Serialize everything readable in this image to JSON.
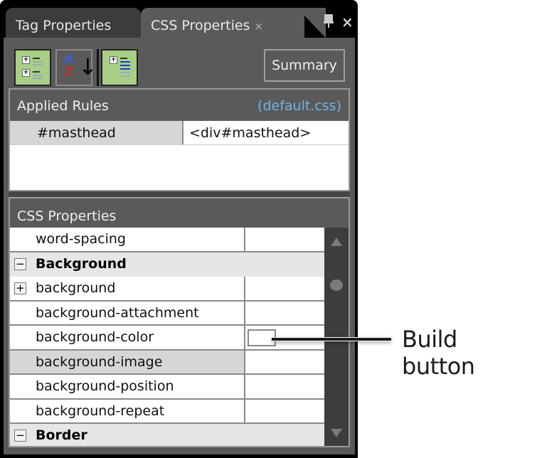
{
  "tabs": [
    {
      "label": "Tag Properties",
      "active": false
    },
    {
      "label": "CSS Properties",
      "active": true,
      "close_glyph": "×"
    }
  ],
  "window_controls": {
    "pin": "pin-icon",
    "close": "×"
  },
  "toolbar": {
    "buttons": [
      {
        "name": "show-categorized-list",
        "icon": "categorized-list-icon",
        "active": true
      },
      {
        "name": "show-alphabetized-list",
        "icon": "sort-az-icon",
        "active": false,
        "a": "A",
        "z": "Z",
        "arrow": "↓"
      },
      {
        "name": "show-set-properties-on-top",
        "icon": "set-properties-icon",
        "active": true
      }
    ],
    "summary_label": "Summary"
  },
  "applied_rules": {
    "header": "Applied Rules",
    "source": "(default.css)",
    "rows": [
      {
        "selector": "#masthead",
        "element": "<div#masthead>"
      }
    ]
  },
  "css_properties": {
    "header": "CSS Properties",
    "rows": [
      {
        "type": "prop",
        "name": "word-spacing",
        "value": ""
      },
      {
        "type": "category",
        "name": "Background",
        "expander": "−"
      },
      {
        "type": "prop",
        "name": "background",
        "value": "",
        "expander": "+"
      },
      {
        "type": "prop",
        "name": "background-attachment",
        "value": ""
      },
      {
        "type": "prop",
        "name": "background-color",
        "value": "",
        "has_build_button": true
      },
      {
        "type": "prop",
        "name": "background-image",
        "value": "",
        "selected": true
      },
      {
        "type": "prop",
        "name": "background-position",
        "value": ""
      },
      {
        "type": "prop",
        "name": "background-repeat",
        "value": ""
      },
      {
        "type": "category",
        "name": "Border",
        "expander": "−"
      }
    ]
  },
  "callout": {
    "label": "Build button"
  },
  "colors": {
    "active_button": "#a9cf86",
    "rule_source_link": "#6fb4e8",
    "panel_bg": "#5a5a5a"
  }
}
